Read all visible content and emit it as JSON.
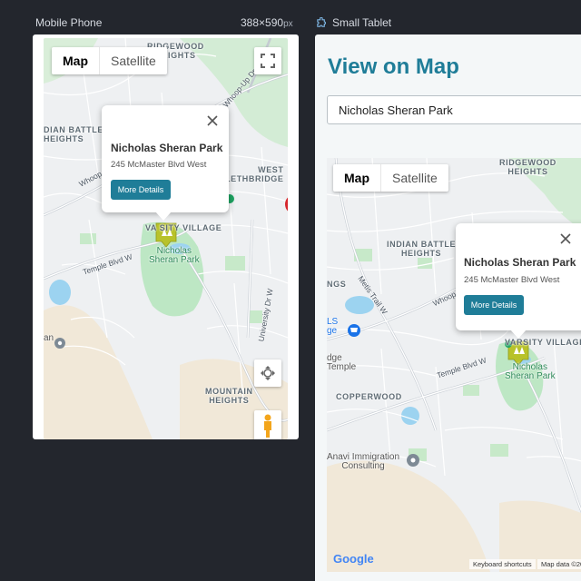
{
  "phone_frame": {
    "label": "Mobile Phone",
    "size": "388×590",
    "size_unit": "px"
  },
  "tablet_frame": {
    "label": "Small Tablet",
    "title": "View on Map",
    "search_value": "Nicholas Sheran Park"
  },
  "map": {
    "type_map": "Map",
    "type_satellite": "Satellite",
    "info_title": "Nicholas Sheran Park",
    "info_address": "245 McMaster Blvd West",
    "info_button": "More Details",
    "google": "Google",
    "keyboard_shortcuts": "Keyboard shortcuts",
    "map_data": "Map data ©20",
    "labels": {
      "ridgewood": "RIDGEWOOD\nHEIGHTS",
      "indian_battle": "INDIAN BATTLE\nHEIGHTS",
      "indian_battle_short": "DIAN BATTLE\nHEIGHTS",
      "west_lethbridge": "WEST\nLETHBRIDGE",
      "varsity_village": "VARSITY VILLAGE",
      "varsity_village_short": "VA  SITY VILLAGE",
      "nicholas_sheran": "Nicholas\nSheran Park",
      "temple_blvd": "Temple Blvd W",
      "university_dr": "University Dr W",
      "whoop_up": "Whoop-Up Dr",
      "whoop": "Whoop",
      "metis": "Metis Trail W",
      "mountain_heights": "MOUNTAIN\nHEIGHTS",
      "copperwood": "COPPERWOOD",
      "anavi": "Anavi Immigration\nConsulting",
      "ngs": "NGS",
      "els": "LS\nge",
      "edge_temple": "dge\nTemple",
      "an": "an"
    }
  },
  "colors": {
    "accent": "#1f7d98",
    "park_green": "#bde7c4",
    "water": "#9cd3f0",
    "map_bg": "#eef0f2"
  }
}
